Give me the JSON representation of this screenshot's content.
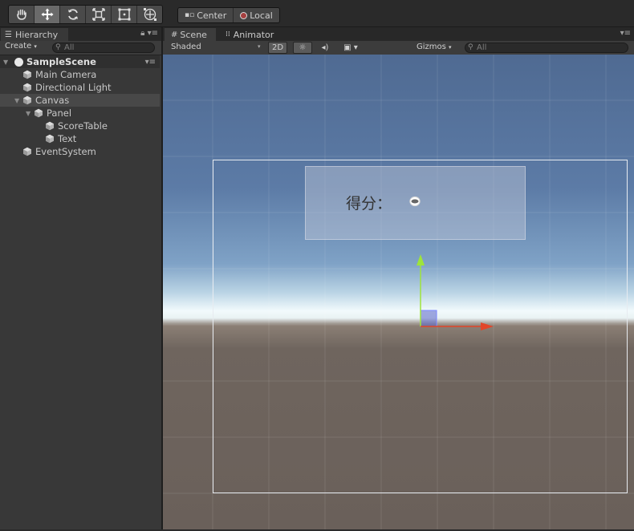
{
  "toolbar": {
    "tools": [
      {
        "icon": "hand-icon"
      },
      {
        "icon": "move-icon",
        "active": true
      },
      {
        "icon": "rotate-icon"
      },
      {
        "icon": "scale-icon"
      },
      {
        "icon": "rect-tool-icon"
      },
      {
        "icon": "transform-tool-icon"
      }
    ],
    "pivot_label": "Center",
    "space_label": "Local"
  },
  "hierarchy": {
    "tab_label": "Hierarchy",
    "create_label": "Create",
    "search_placeholder": "All",
    "scene_name": "SampleScene",
    "items": [
      {
        "label": "Main Camera",
        "depth": 1,
        "selected": false
      },
      {
        "label": "Directional Light",
        "depth": 1,
        "selected": false
      },
      {
        "label": "Canvas",
        "depth": 1,
        "selected": true,
        "expanded": true
      },
      {
        "label": "Panel",
        "depth": 2,
        "selected": false,
        "expanded": true
      },
      {
        "label": "ScoreTable",
        "depth": 3,
        "selected": false
      },
      {
        "label": "Text",
        "depth": 3,
        "selected": false
      },
      {
        "label": "EventSystem",
        "depth": 1,
        "selected": false
      }
    ]
  },
  "scene": {
    "tab_label": "Scene",
    "animator_tab_label": "Animator",
    "shading_mode": "Shaded",
    "mode_2d_label": "2D",
    "gizmos_label": "Gizmos",
    "search_placeholder": "All",
    "ui_score_label": "得分：",
    "colors": {
      "x_axis": "#e2462a",
      "y_axis": "#9ee43a",
      "selection_outline": "#e7ebf0"
    }
  }
}
